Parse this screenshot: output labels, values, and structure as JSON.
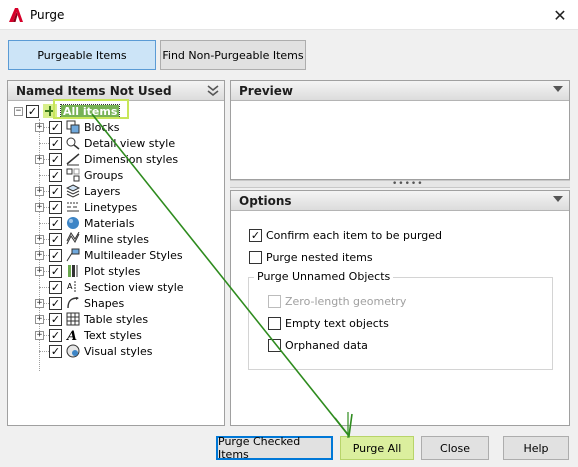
{
  "window": {
    "title": "Purge",
    "close_glyph": "✕"
  },
  "tabs": [
    {
      "label": "Purgeable Items",
      "active": true
    },
    {
      "label": "Find Non-Purgeable Items",
      "active": false
    }
  ],
  "left_panel": {
    "title": "Named Items Not Used",
    "root": {
      "label": "All items",
      "checked": true,
      "expander": "−"
    },
    "items": [
      {
        "label": "Blocks",
        "icon": "blocks-icon",
        "expander": "+",
        "checked": true
      },
      {
        "label": "Detail view style",
        "icon": "detail-view-style-icon",
        "expander": "",
        "checked": true
      },
      {
        "label": "Dimension styles",
        "icon": "dimension-style-icon",
        "expander": "+",
        "checked": true
      },
      {
        "label": "Groups",
        "icon": "groups-icon",
        "expander": "",
        "checked": true
      },
      {
        "label": "Layers",
        "icon": "layers-icon",
        "expander": "+",
        "checked": true
      },
      {
        "label": "Linetypes",
        "icon": "linetypes-icon",
        "expander": "+",
        "checked": true
      },
      {
        "label": "Materials",
        "icon": "materials-icon",
        "expander": "",
        "checked": true
      },
      {
        "label": "Mline styles",
        "icon": "mline-styles-icon",
        "expander": "+",
        "checked": true
      },
      {
        "label": "Multileader Styles",
        "icon": "multileader-styles-icon",
        "expander": "+",
        "checked": true
      },
      {
        "label": "Plot styles",
        "icon": "plot-styles-icon",
        "expander": "+",
        "checked": true
      },
      {
        "label": "Section view style",
        "icon": "section-view-style-icon",
        "expander": "",
        "checked": true
      },
      {
        "label": "Shapes",
        "icon": "shapes-icon",
        "expander": "+",
        "checked": true
      },
      {
        "label": "Table styles",
        "icon": "table-styles-icon",
        "expander": "+",
        "checked": true
      },
      {
        "label": "Text styles",
        "icon": "text-styles-icon",
        "expander": "+",
        "checked": true
      },
      {
        "label": "Visual styles",
        "icon": "visual-styles-icon",
        "expander": "",
        "checked": true
      }
    ]
  },
  "preview": {
    "title": "Preview"
  },
  "options": {
    "title": "Options",
    "confirm_each": {
      "label": "Confirm each item to be purged",
      "checked": true
    },
    "purge_nested": {
      "label": "Purge nested items",
      "checked": false
    },
    "unnamed_group": {
      "title": "Purge Unnamed Objects",
      "zero_length": {
        "label": "Zero-length geometry",
        "checked": false,
        "enabled": false
      },
      "empty_text": {
        "label": "Empty text objects",
        "checked": false,
        "enabled": true
      },
      "orphaned_data": {
        "label": "Orphaned data",
        "checked": false,
        "enabled": true
      }
    }
  },
  "buttons": {
    "purge_checked": "Purge Checked Items",
    "purge_all": "Purge All",
    "close": "Close",
    "help": "Help"
  },
  "colors": {
    "annotation_green": "#2e8b1e",
    "highlight_green": "#dbef9e",
    "all_items_bg": "#77b255",
    "accent_blue": "#0078d7"
  }
}
